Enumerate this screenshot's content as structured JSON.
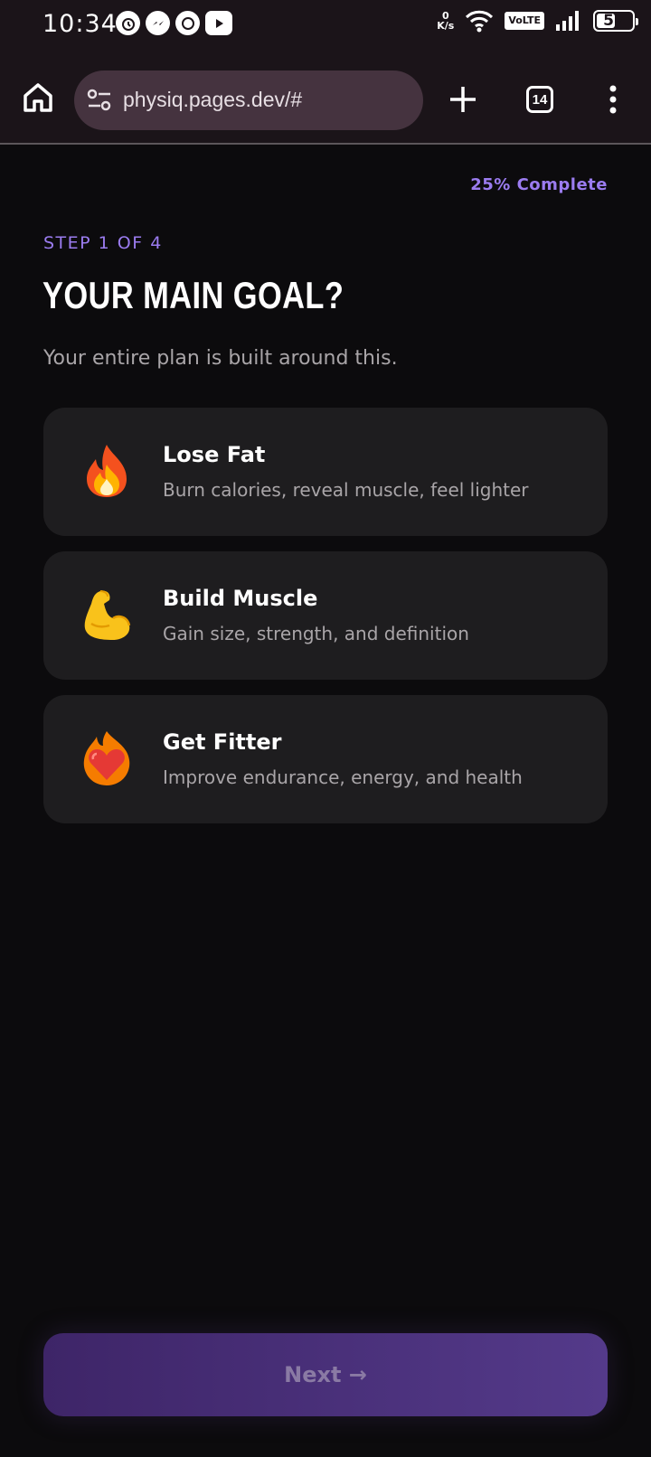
{
  "status_bar": {
    "time": "10:34",
    "net_speed_value": "0",
    "net_speed_unit": "K/s",
    "volte": "VoLTE",
    "battery": "57"
  },
  "browser": {
    "url": "physiq.pages.dev/#",
    "tab_count": "14"
  },
  "page": {
    "progress_text": "25% Complete",
    "progress_fraction": 0.25,
    "step_label": "STEP 1 OF 4",
    "title": "YOUR MAIN GOAL?",
    "subtitle": "Your entire plan is built around this.",
    "options": [
      {
        "icon": "fire-icon",
        "title": "Lose Fat",
        "description": "Burn calories, reveal muscle, feel lighter"
      },
      {
        "icon": "flexed-biceps-icon",
        "title": "Build Muscle",
        "description": "Gain size, strength, and definition"
      },
      {
        "icon": "heart-on-fire-icon",
        "title": "Get Fitter",
        "description": "Improve endurance, energy, and health"
      }
    ],
    "next_label": "Next →"
  },
  "colors": {
    "accent": "#9b7cf0",
    "background": "#0c0b0d",
    "card": "#1e1d1f",
    "button_start": "#3e2568",
    "button_end": "#543a8a"
  }
}
